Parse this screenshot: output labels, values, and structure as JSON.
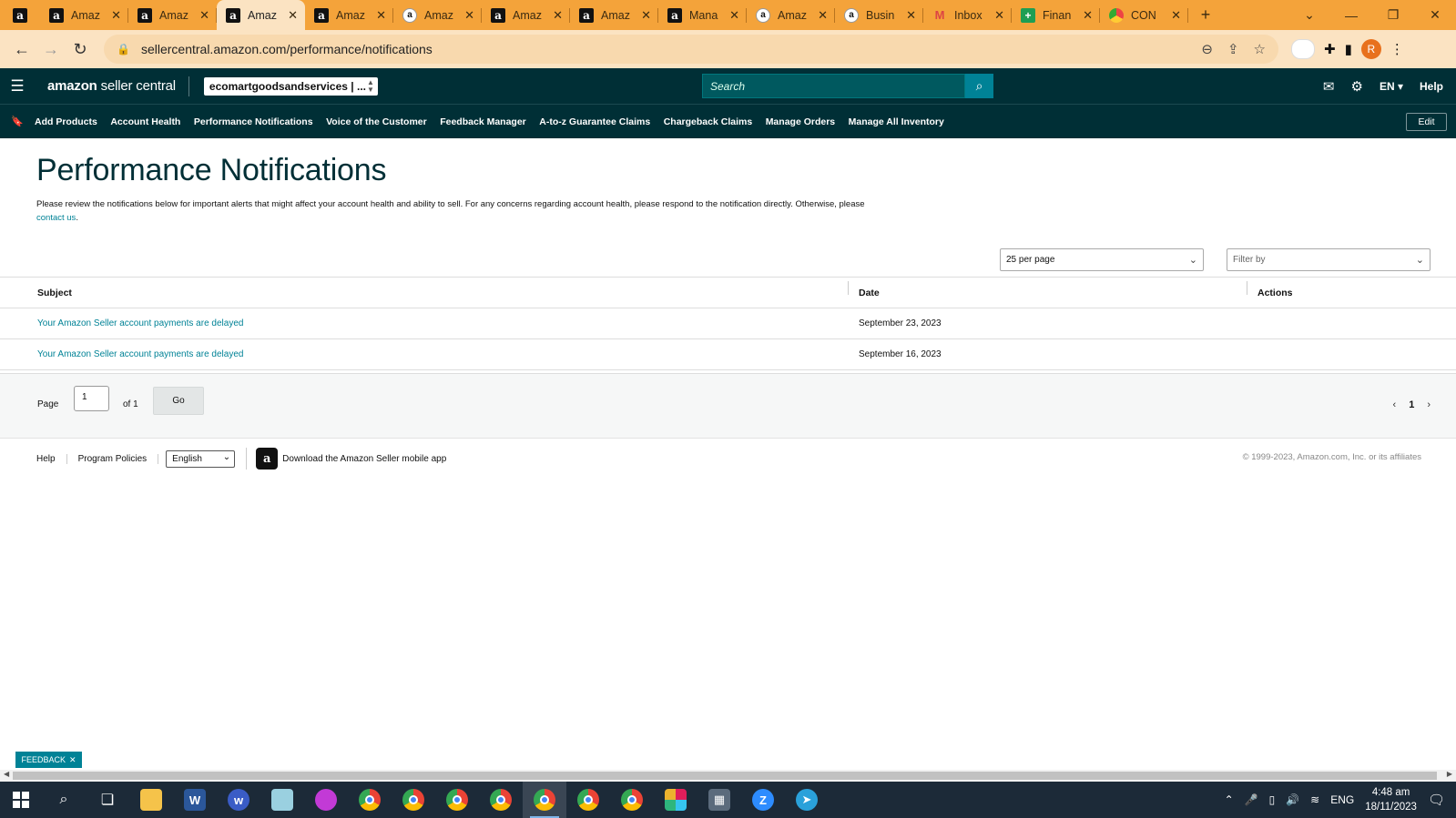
{
  "browser": {
    "tabs": [
      {
        "label": "",
        "icon": "amazon-icon",
        "active": false
      },
      {
        "label": "Amaz",
        "icon": "amazon-icon",
        "active": false
      },
      {
        "label": "Amaz",
        "icon": "amazon-icon",
        "active": false
      },
      {
        "label": "Amaz",
        "icon": "amazon-icon",
        "active": true
      },
      {
        "label": "Amaz",
        "icon": "amazon-icon",
        "active": false
      },
      {
        "label": "Amaz",
        "icon": "amazon-round-icon",
        "active": false
      },
      {
        "label": "Amaz",
        "icon": "amazon-icon",
        "active": false
      },
      {
        "label": "Amaz",
        "icon": "amazon-icon",
        "active": false
      },
      {
        "label": "Mana",
        "icon": "amazon-icon",
        "active": false
      },
      {
        "label": "Amaz",
        "icon": "amazon-round-icon",
        "active": false
      },
      {
        "label": "Busin",
        "icon": "amazon-round-icon",
        "active": false
      },
      {
        "label": "Inbox",
        "icon": "gmail-icon",
        "active": false
      },
      {
        "label": "Finan",
        "icon": "sheets-icon",
        "active": false
      },
      {
        "label": "CON",
        "icon": "chrome-icon",
        "active": false
      }
    ],
    "url": "sellercentral.amazon.com/performance/notifications",
    "profile_initial": "R"
  },
  "header": {
    "logo_brand": "amazon",
    "logo_product": "seller central",
    "account": "ecomartgoodsandservices | ...",
    "search_placeholder": "Search",
    "language": "EN",
    "help": "Help"
  },
  "nav": {
    "links": [
      "Add Products",
      "Account Health",
      "Performance Notifications",
      "Voice of the Customer",
      "Feedback Manager",
      "A-to-z Guarantee Claims",
      "Chargeback Claims",
      "Manage Orders",
      "Manage All Inventory"
    ],
    "edit": "Edit"
  },
  "page": {
    "title": "Performance Notifications",
    "intro": "Please review the notifications below for important alerts that might affect your account health and ability to sell. For any concerns regarding account health, please respond to the notification directly. Otherwise, please",
    "intro_link": "contact us",
    "intro_end": ".",
    "per_page": "25 per page",
    "filter_placeholder": "Filter by"
  },
  "table": {
    "headers": {
      "subject": "Subject",
      "date": "Date",
      "actions": "Actions"
    },
    "rows": [
      {
        "subject": "Your Amazon Seller account payments are delayed",
        "date": "September 23, 2023"
      },
      {
        "subject": "Your Amazon Seller account payments are delayed",
        "date": "September 16, 2023"
      }
    ]
  },
  "pagination": {
    "page_label": "Page",
    "page_value": "1",
    "of_label": "of 1",
    "go_label": "Go",
    "current": "1"
  },
  "footer": {
    "help": "Help",
    "policies": "Program Policies",
    "language": "English",
    "app_text": "Download the Amazon Seller mobile app",
    "copyright": "© 1999-2023, Amazon.com, Inc. or its affiliates"
  },
  "feedback": "FEEDBACK",
  "taskbar": {
    "language": "ENG",
    "time": "4:48 am",
    "date": "18/11/2023"
  },
  "colors": {
    "header_bg": "#002f36",
    "accent": "#008296",
    "tabstrip": "#f4a33a"
  }
}
